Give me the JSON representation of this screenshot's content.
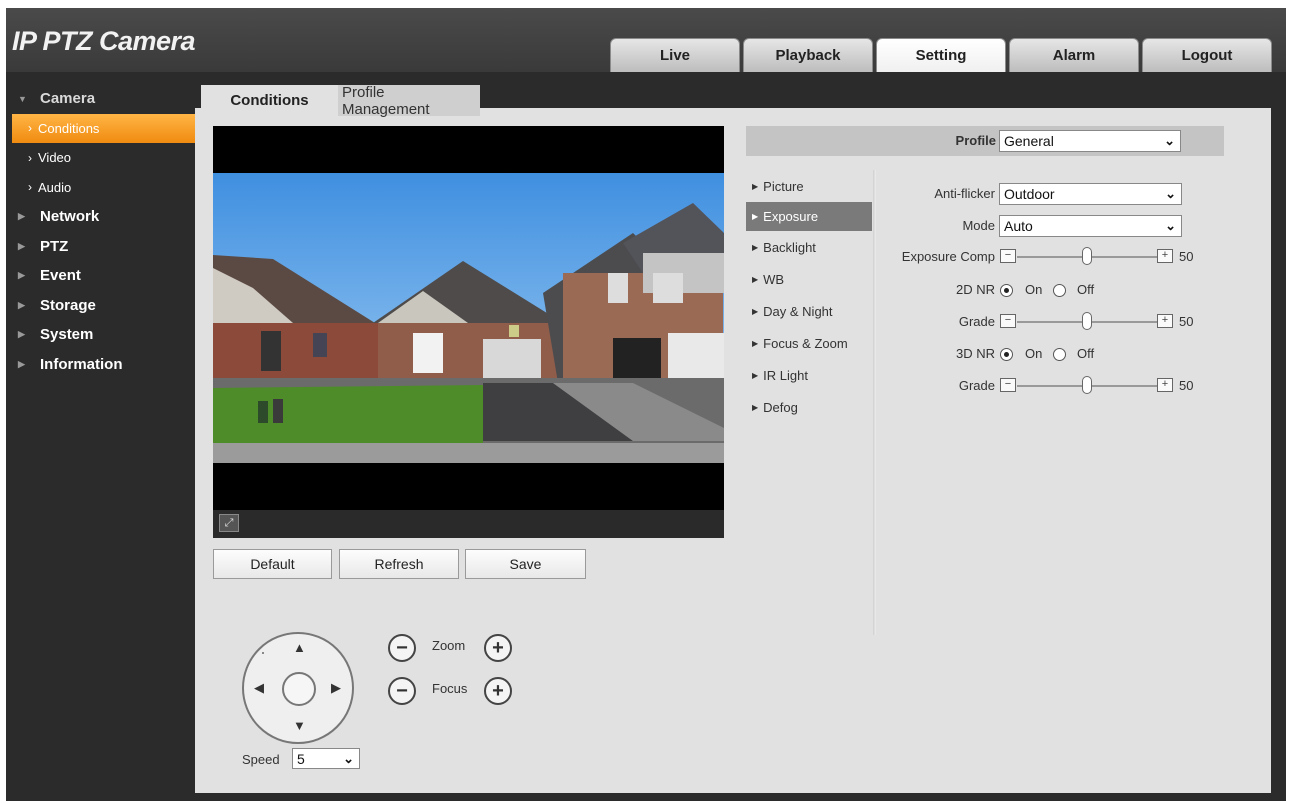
{
  "app": {
    "title": "IP PTZ Camera"
  },
  "top_nav": [
    {
      "label": "Live",
      "active": false
    },
    {
      "label": "Playback",
      "active": false
    },
    {
      "label": "Setting",
      "active": true
    },
    {
      "label": "Alarm",
      "active": false
    },
    {
      "label": "Logout",
      "active": false
    }
  ],
  "sidebar": {
    "camera": "Camera",
    "camera_items": [
      "Conditions",
      "Video",
      "Audio"
    ],
    "groups": [
      "Network",
      "PTZ",
      "Event",
      "Storage",
      "System",
      "Information"
    ]
  },
  "sub_tabs": [
    "Conditions",
    "Profile Management"
  ],
  "actions": {
    "default": "Default",
    "refresh": "Refresh",
    "save": "Save"
  },
  "ptz": {
    "zoom": "Zoom",
    "focus": "Focus",
    "speed_label": "Speed",
    "speed_value": "5",
    "minus": "−",
    "plus": "+"
  },
  "profile": {
    "label": "Profile",
    "value": "General"
  },
  "menu": [
    "Picture",
    "Exposure",
    "Backlight",
    "WB",
    "Day & Night",
    "Focus & Zoom",
    "IR Light",
    "Defog"
  ],
  "menu_active": "Exposure",
  "exposure": {
    "anti_flicker_label": "Anti-flicker",
    "anti_flicker_value": "Outdoor",
    "mode_label": "Mode",
    "mode_value": "Auto",
    "exposure_comp_label": "Exposure Comp",
    "exposure_comp_value": "50",
    "nr2d_label": "2D NR",
    "nr2d_on": "On",
    "nr2d_off": "Off",
    "nr2d_state": "On",
    "grade1_label": "Grade",
    "grade1_value": "50",
    "nr3d_label": "3D NR",
    "nr3d_on": "On",
    "nr3d_off": "Off",
    "nr3d_state": "On",
    "grade2_label": "Grade",
    "grade2_value": "50"
  },
  "colors": {
    "accent": "#f59a1f",
    "header": "#404040",
    "panel": "#e1e1e1"
  }
}
